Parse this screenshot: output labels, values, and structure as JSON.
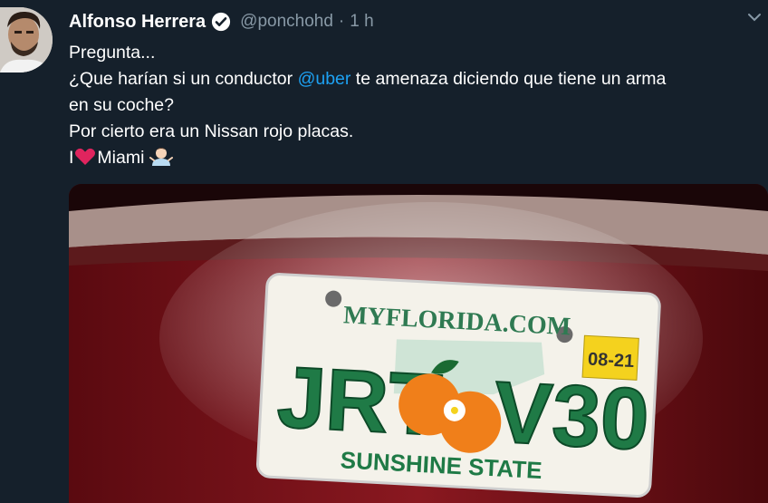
{
  "tweet": {
    "author_name": "Alfonso Herrera",
    "author_handle": "@ponchohd",
    "separator": "·",
    "time": "1 h",
    "verified_icon": "verified-badge-icon",
    "caret_icon": "chevron-down-icon",
    "lines": {
      "l1": "Pregunta...",
      "l2_pre": "¿Que harían si un conductor ",
      "l2_mention": "@uber",
      "l2_post": " te amenaza diciendo que tiene un arma",
      "l3": "en su coche?",
      "l4": "Por cierto era un Nissan rojo placas.",
      "l5_pre": "I",
      "l5_heart": "heart-emoji",
      "l5_post": "Miami",
      "l5_shrug": "shrug-emoji"
    }
  },
  "photo": {
    "plate_site": "MYFLORIDA.COM",
    "plate_number_left": "JRT",
    "plate_number_right": "V30",
    "plate_sticker": "08-21",
    "plate_motto": "SUNSHINE STATE"
  },
  "colors": {
    "background": "#15202b",
    "text": "#ffffff",
    "secondary": "#8899a6",
    "link": "#1da1f2",
    "heart": "#e0245e",
    "plate_green": "#1f7a46",
    "car_red": "#7a1018"
  }
}
